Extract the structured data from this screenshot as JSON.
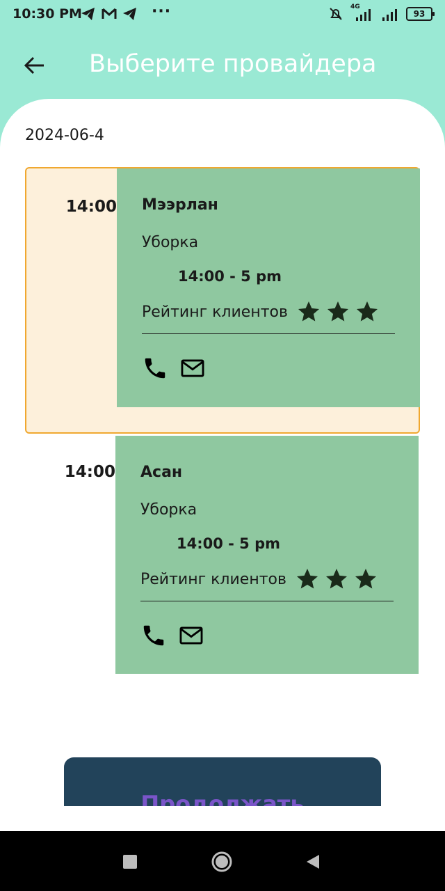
{
  "status_bar": {
    "time": "10:30 PM",
    "dots": "···",
    "network": "4G",
    "battery": "93"
  },
  "app_bar": {
    "title": "Выберите провайдера",
    "back_icon": "arrow-left-icon"
  },
  "date": "2024-06-4",
  "slots": [
    {
      "time": "14:00",
      "selected": true,
      "provider": "Мээрлан",
      "service": "Уборка",
      "hours": "14:00 - 5 pm",
      "rating_label": "Рейтинг клиентов",
      "stars": 3
    },
    {
      "time": "14:00",
      "selected": false,
      "provider": "Асан",
      "service": "Уборка",
      "hours": "14:00 - 5 pm",
      "rating_label": "Рейтинг клиентов",
      "stars": 3
    }
  ],
  "continue_button": "Продолжать",
  "colors": {
    "accent": "#9ae9d4",
    "card": "#8fc8a0",
    "selected_bg": "#fdf0db",
    "selected_border": "#f0a830",
    "button": "#22435a",
    "button_text": "#7a55c8"
  }
}
